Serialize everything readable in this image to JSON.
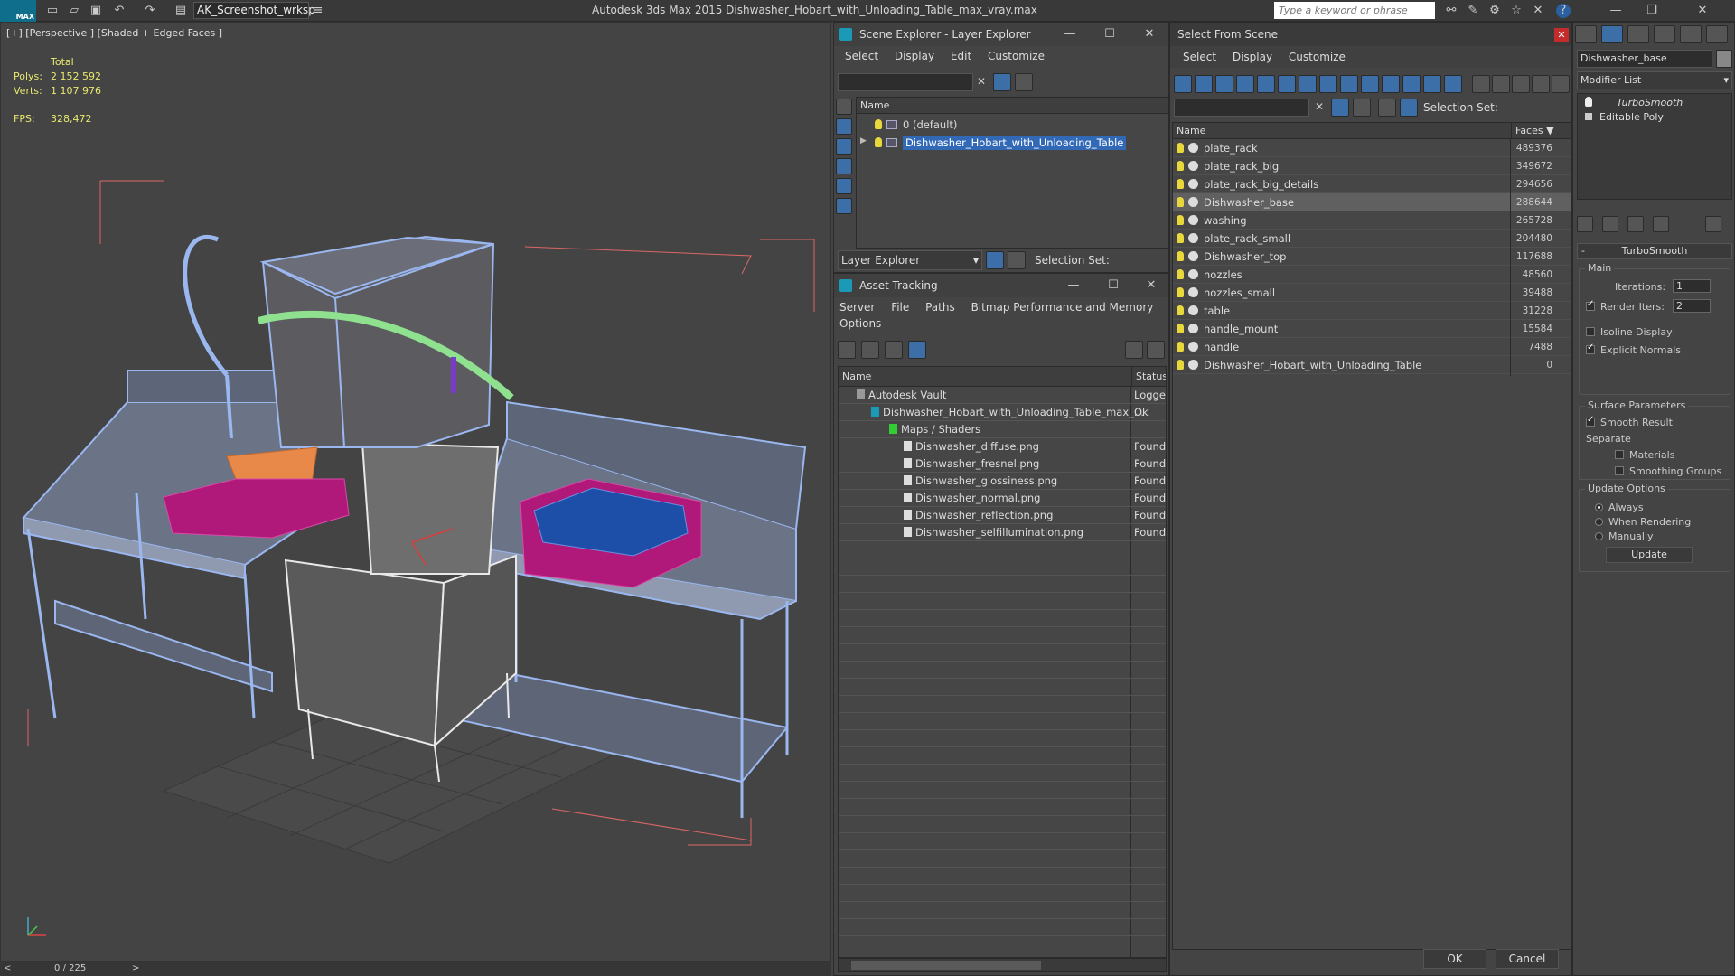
{
  "titlebar": {
    "logo": "MAX",
    "workspace": "AK_Screenshot_wrksp",
    "title": "Autodesk 3ds Max  2015     Dishwasher_Hobart_with_Unloading_Table_max_vray.max",
    "search_placeholder": "Type a keyword or phrase"
  },
  "viewport": {
    "label": "[+] [Perspective ] [Shaded + Edged Faces ]",
    "stats": {
      "total_label": "Total",
      "polys_label": "Polys:",
      "polys": "2 152 592",
      "verts_label": "Verts:",
      "verts": "1 107 976",
      "fps_label": "FPS:",
      "fps": "328,472"
    },
    "timeline": "0 / 225"
  },
  "scene_explorer": {
    "title": "Scene Explorer - Layer Explorer",
    "menu": [
      "Select",
      "Display",
      "Edit",
      "Customize"
    ],
    "col_name": "Name",
    "rows": [
      "0 (default)",
      "Dishwasher_Hobart_with_Unloading_Table"
    ],
    "footer_layer": "Layer Explorer",
    "footer_selset": "Selection Set:"
  },
  "asset_tracking": {
    "title": "Asset Tracking",
    "menu": [
      "Server",
      "File",
      "Paths",
      "Bitmap Performance and Memory",
      "Options"
    ],
    "col_name": "Name",
    "col_status": "Status",
    "rows": [
      {
        "name": "Autodesk Vault",
        "status": "Logge"
      },
      {
        "name": "Dishwasher_Hobart_with_Unloading_Table_max_...",
        "status": "Ok"
      },
      {
        "name": "Maps / Shaders",
        "status": ""
      },
      {
        "name": "Dishwasher_diffuse.png",
        "status": "Found"
      },
      {
        "name": "Dishwasher_fresnel.png",
        "status": "Found"
      },
      {
        "name": "Dishwasher_glossiness.png",
        "status": "Found"
      },
      {
        "name": "Dishwasher_normal.png",
        "status": "Found"
      },
      {
        "name": "Dishwasher_reflection.png",
        "status": "Found"
      },
      {
        "name": "Dishwasher_selfillumination.png",
        "status": "Found"
      }
    ]
  },
  "select_from_scene": {
    "title": "Select From Scene",
    "menu": [
      "Select",
      "Display",
      "Customize"
    ],
    "selset_label": "Selection Set:",
    "col_name": "Name",
    "col_faces": "Faces",
    "rows": [
      {
        "name": "plate_rack",
        "faces": "489376"
      },
      {
        "name": "plate_rack_big",
        "faces": "349672"
      },
      {
        "name": "plate_rack_big_details",
        "faces": "294656"
      },
      {
        "name": "Dishwasher_base",
        "faces": "288644"
      },
      {
        "name": "washing",
        "faces": "265728"
      },
      {
        "name": "plate_rack_small",
        "faces": "204480"
      },
      {
        "name": "Dishwasher_top",
        "faces": "117688"
      },
      {
        "name": "nozzles",
        "faces": "48560"
      },
      {
        "name": "nozzles_small",
        "faces": "39488"
      },
      {
        "name": "table",
        "faces": "31228"
      },
      {
        "name": "handle_mount",
        "faces": "15584"
      },
      {
        "name": "handle",
        "faces": "7488"
      },
      {
        "name": "Dishwasher_Hobart_with_Unloading_Table",
        "faces": "0"
      }
    ],
    "ok": "OK",
    "cancel": "Cancel"
  },
  "command_panel": {
    "object_name": "Dishwasher_base",
    "modifier_list": "Modifier List",
    "stack": [
      "TurboSmooth",
      "Editable Poly"
    ],
    "rollout": "TurboSmooth",
    "main": "Main",
    "iterations_label": "Iterations:",
    "iterations": "1",
    "render_iters_label": "Render Iters:",
    "render_iters": "2",
    "isoline": "Isoline Display",
    "explicit_normals": "Explicit Normals",
    "surface_params": "Surface Parameters",
    "smooth_result": "Smooth Result",
    "separate": "Separate",
    "materials": "Materials",
    "smoothing_groups": "Smoothing Groups",
    "update_options": "Update Options",
    "always": "Always",
    "when_rendering": "When Rendering",
    "manually": "Manually",
    "update_btn": "Update"
  },
  "colors": {
    "selection": "#3269b7",
    "wire": "#9bb7f0",
    "rack_magenta": "#b0187a",
    "rack_blue": "#1e4fa8",
    "basket_orange": "#e8894a",
    "hose_green": "#8fe08f"
  }
}
